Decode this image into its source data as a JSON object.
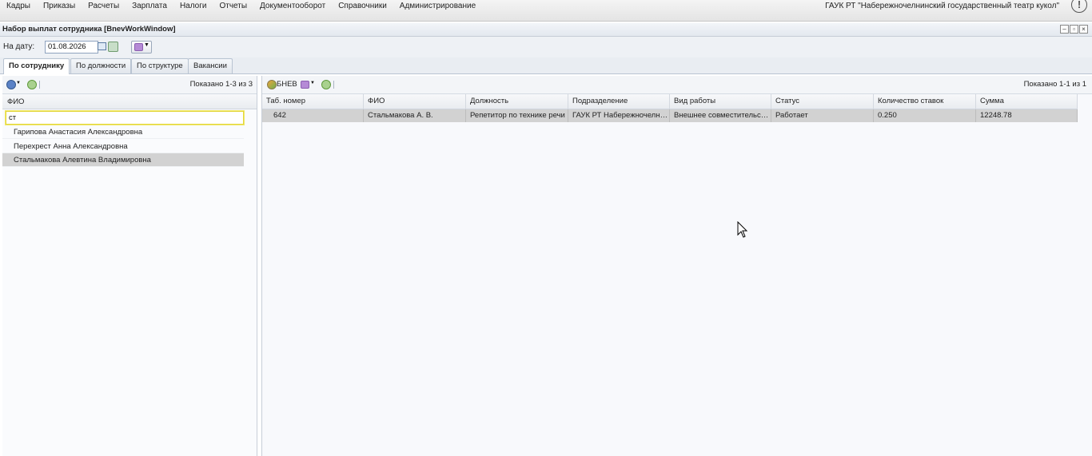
{
  "menu": [
    "Кадры",
    "Приказы",
    "Расчеты",
    "Зарплата",
    "Налоги",
    "Отчеты",
    "Документооборот",
    "Справочники",
    "Администрирование"
  ],
  "org_name": "ГАУК РТ \"Набережночелнинский государственный театр кукол\"",
  "info_icon": "!",
  "window": {
    "title": "Набор выплат сотрудника [BnevWorkWindow]",
    "buttons": [
      "minimize-icon",
      "restore-icon",
      "close-icon"
    ]
  },
  "date_bar": {
    "label": "На дату:",
    "date": "01.08.2026"
  },
  "tabs": [
    "По сотруднику",
    "По должности",
    "По структуре",
    "Вакансии"
  ],
  "left": {
    "count": "Показано 1-3 из 3",
    "column": "ФИО",
    "search_value": "ст",
    "employees": [
      "Гарипова Анастасия Александровна",
      "Перехрест Анна Александровна",
      "Стальмакова Алевтина Владимировна"
    ],
    "selected_index": 2
  },
  "right": {
    "toolbar_label": "БНЕВ",
    "count": "Показано 1-1 из 1",
    "columns": [
      "Таб. номер",
      "ФИО",
      "Должность",
      "Подразделение",
      "Вид работы",
      "Статус",
      "Количество ставок",
      "Сумма"
    ],
    "row": [
      "642",
      "Стальмакова А. В.",
      "Репетитор по технике речи",
      "ГАУК РТ Набережночелнинский государственный театр кукол",
      "Внешнее совместительство",
      "Работает",
      "0.250",
      "12248.78"
    ]
  },
  "colors": {
    "selected_row": "#d2d2d2",
    "search_border": "#e3d63a",
    "accent": "#b58ad6"
  }
}
